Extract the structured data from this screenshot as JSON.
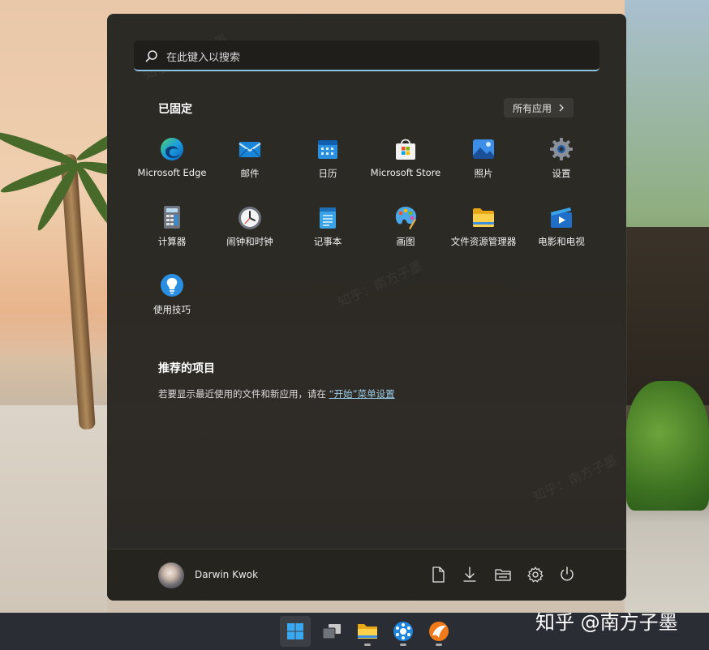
{
  "search": {
    "placeholder": "在此键入以搜索"
  },
  "pinned": {
    "title": "已固定",
    "all_apps": "所有应用",
    "apps": [
      {
        "label": "Microsoft Edge",
        "icon": "edge-icon"
      },
      {
        "label": "邮件",
        "icon": "mail-icon"
      },
      {
        "label": "日历",
        "icon": "calendar-icon"
      },
      {
        "label": "Microsoft Store",
        "icon": "store-icon"
      },
      {
        "label": "照片",
        "icon": "photos-icon"
      },
      {
        "label": "设置",
        "icon": "settings-icon"
      },
      {
        "label": "计算器",
        "icon": "calculator-icon"
      },
      {
        "label": "闹钟和时钟",
        "icon": "clock-icon"
      },
      {
        "label": "记事本",
        "icon": "notepad-icon"
      },
      {
        "label": "画图",
        "icon": "paint-icon"
      },
      {
        "label": "文件资源管理器",
        "icon": "file-explorer-icon"
      },
      {
        "label": "电影和电视",
        "icon": "movies-tv-icon"
      },
      {
        "label": "使用技巧",
        "icon": "tips-icon"
      }
    ]
  },
  "recommended": {
    "title": "推荐的项目",
    "text": "若要显示最近使用的文件和新应用，请在",
    "link": "“开始”菜单设置"
  },
  "footer": {
    "username": "Darwin Kwok"
  },
  "watermark": "知乎 @南方子墨",
  "bg_watermark": "知乎：南方子墨",
  "colors": {
    "accent": "#8fc2e0",
    "panel": "#2b2a25",
    "taskbar": "#2a2d33"
  }
}
